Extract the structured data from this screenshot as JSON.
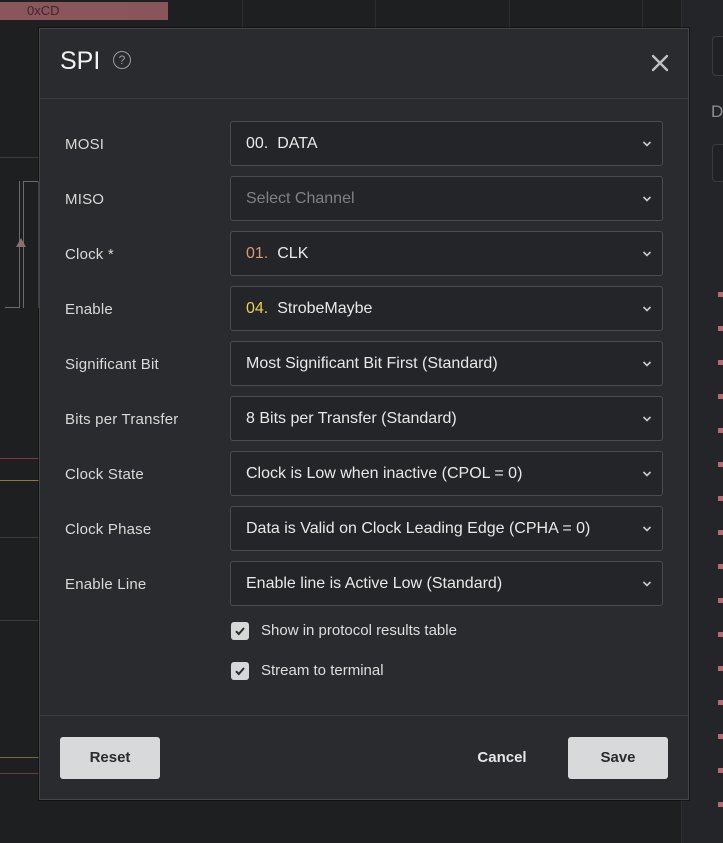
{
  "background": {
    "hex_tag": "0xCD",
    "side_letter": "D"
  },
  "dialog": {
    "title": "SPI",
    "help_glyph": "?",
    "fields": [
      {
        "label": "MOSI",
        "number": "00.",
        "value": "DATA",
        "number_color": "#e6e6e6"
      },
      {
        "label": "MISO",
        "placeholder": "Select Channel"
      },
      {
        "label": "Clock *",
        "number": "01.",
        "value": "CLK",
        "number_color": "#d99a77"
      },
      {
        "label": "Enable",
        "number": "04.",
        "value": "StrobeMaybe",
        "number_color": "#e8d24a"
      },
      {
        "label": "Significant Bit",
        "value": "Most Significant Bit First (Standard)"
      },
      {
        "label": "Bits per Transfer",
        "value": "8 Bits per Transfer (Standard)"
      },
      {
        "label": "Clock State",
        "value": "Clock is Low when inactive (CPOL = 0)"
      },
      {
        "label": "Clock Phase",
        "value": "Data is Valid on Clock Leading Edge (CPHA = 0)"
      },
      {
        "label": "Enable Line",
        "value": "Enable line is Active Low (Standard)"
      }
    ],
    "checkboxes": [
      {
        "label": "Show in protocol results table",
        "checked": true
      },
      {
        "label": "Stream to terminal",
        "checked": true
      }
    ],
    "buttons": {
      "reset": "Reset",
      "cancel": "Cancel",
      "save": "Save"
    }
  },
  "colors": {
    "dialog_bg": "#2a2b2e",
    "button_light": "#d8d9db",
    "clock_number": "#d99a77",
    "enable_number": "#e8d24a"
  }
}
